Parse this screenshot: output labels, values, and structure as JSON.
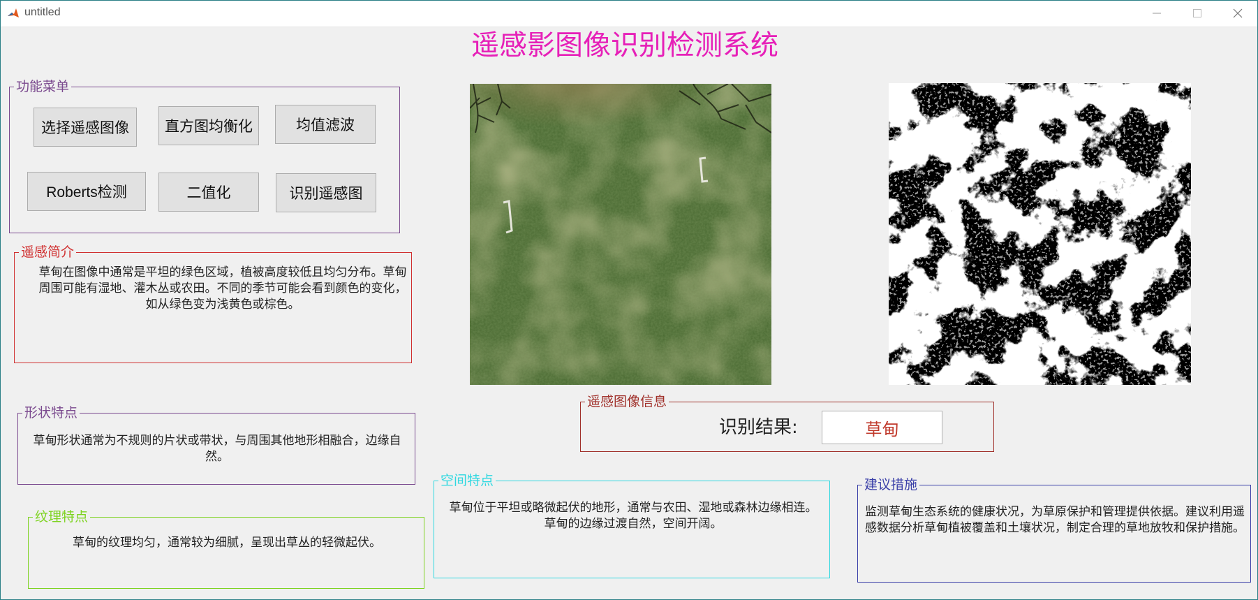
{
  "window": {
    "title": "untitled",
    "icon": "matlab-icon"
  },
  "app_title": "遥感影图像识别检测系统",
  "menu": {
    "title": "功能菜单",
    "buttons": {
      "select_image": "选择遥感图像",
      "histeq": "直方图均衡化",
      "mean_filter": "均值滤波",
      "roberts": "Roberts检测",
      "binarize": "二值化",
      "recognize": "识别遥感图"
    }
  },
  "intro": {
    "title": "遥感简介",
    "text": "草甸在图像中通常是平坦的绿色区域，植被高度较低且均匀分布。草甸周围可能有湿地、灌木丛或农田。不同的季节可能会看到颜色的变化，如从绿色变为浅黄色或棕色。"
  },
  "shape": {
    "title": "形状特点",
    "text": "草甸形状通常为不规则的片状或带状，与周围其他地形相融合，边缘自然。"
  },
  "texture": {
    "title": "纹理特点",
    "text": "草甸的纹理均匀，通常较为细腻，呈现出草丛的轻微起伏。"
  },
  "info": {
    "title": "遥感图像信息",
    "result_label": "识别结果:",
    "result_value": "草甸"
  },
  "spatial": {
    "title": "空间特点",
    "text": "草甸位于平坦或略微起伏的地形，通常与农田、湿地或森林边缘相连。草甸的边缘过渡自然，空间开阔。"
  },
  "suggest": {
    "title": "建议措施",
    "text": "监测草甸生态系统的健康状况，为草原保护和管理提供依据。建议利用遥感数据分析草甸植被覆盖和土壤状况，制定合理的草地放牧和保护措施。"
  },
  "colors": {
    "title": "#e620b8",
    "menu": "#7b4a8f",
    "intro": "#d03030",
    "shape": "#7b4a8f",
    "texture": "#7ed321",
    "info": "#a0302a",
    "spatial": "#2fd8e0",
    "suggest": "#3a3fa8"
  }
}
